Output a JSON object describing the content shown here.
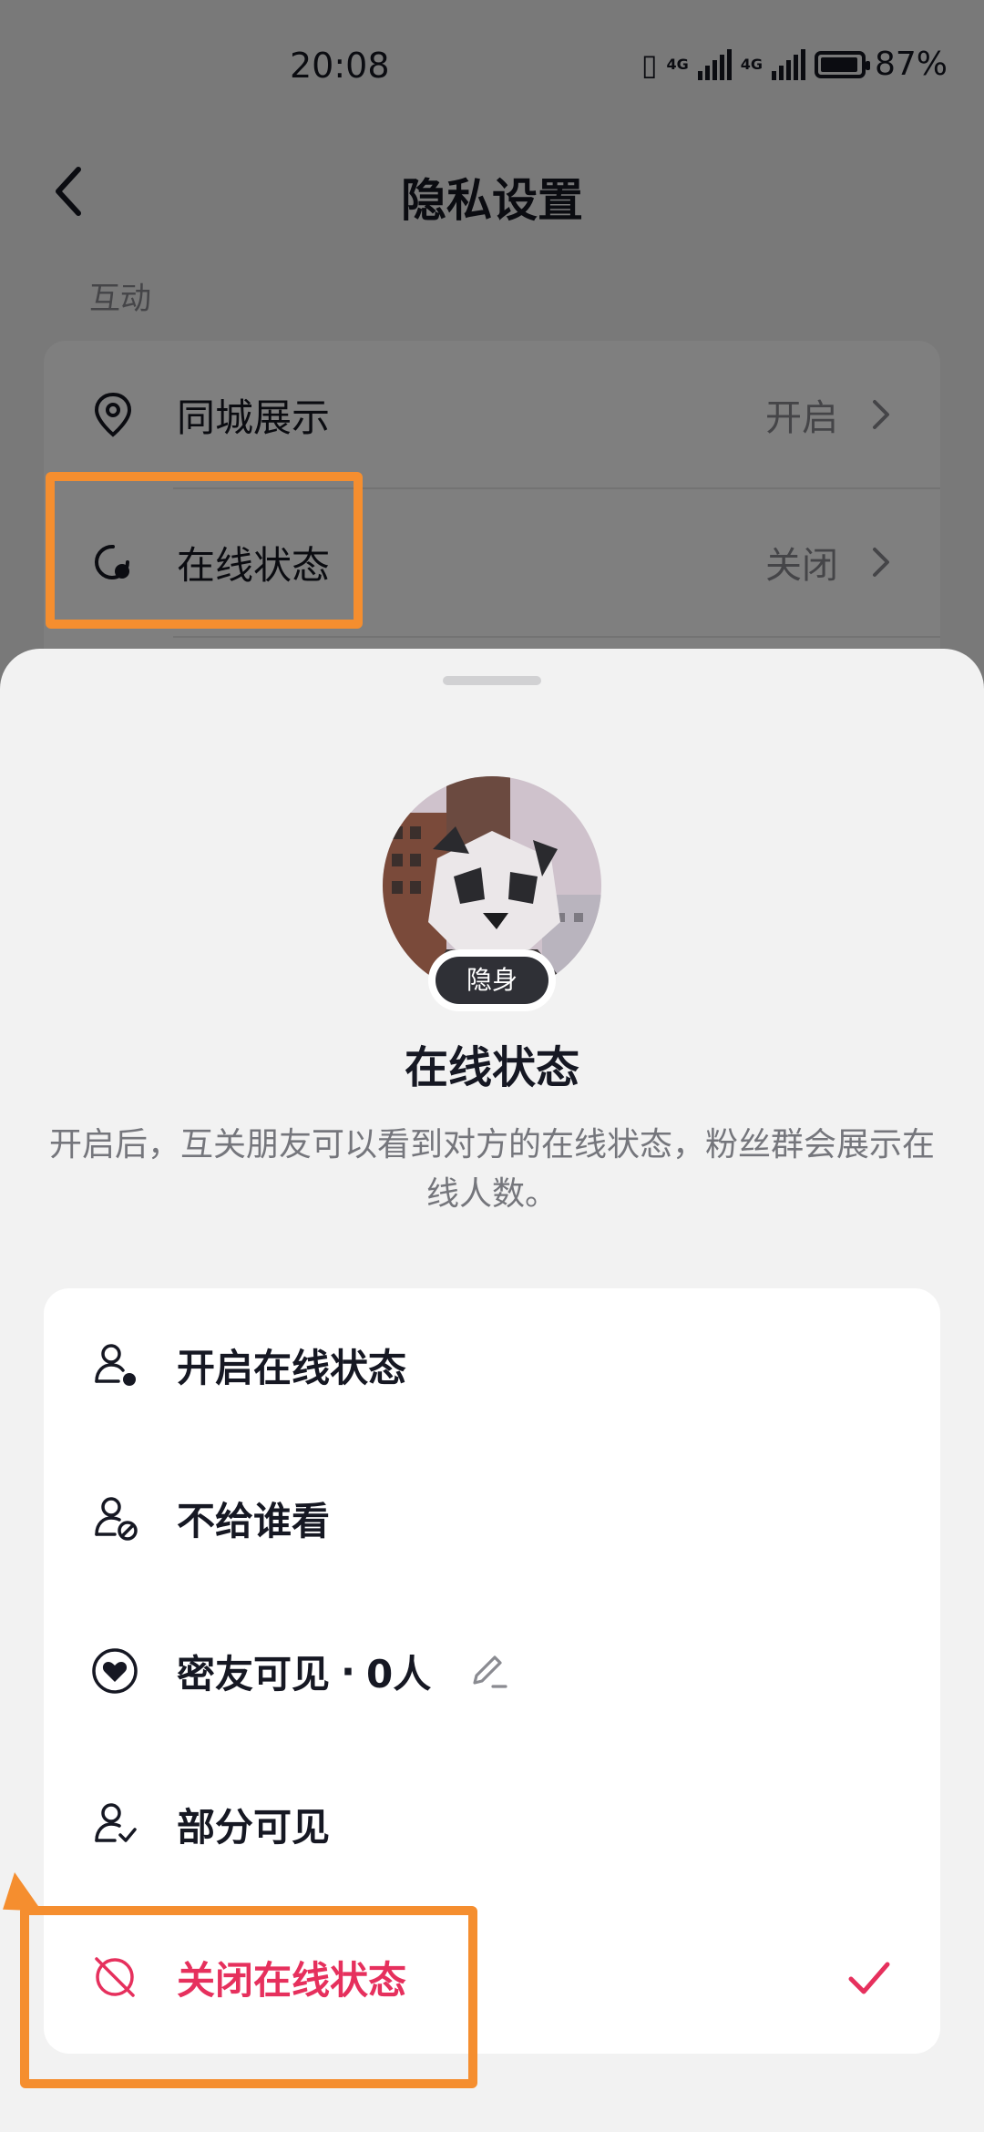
{
  "status_bar": {
    "time": "20:08",
    "net1": "4G",
    "net2": "4G",
    "battery": "87%"
  },
  "header": {
    "title": "隐私设置",
    "back_icon": "chevron-left-icon"
  },
  "section": {
    "label": "互动",
    "rows": [
      {
        "label": "同城展示",
        "value": "开启",
        "icon": "location-pin-icon"
      },
      {
        "label": "在线状态",
        "value": "关闭",
        "icon": "online-status-icon"
      }
    ]
  },
  "sheet": {
    "badge": "隐身",
    "title": "在线状态",
    "description": "开启后，互关朋友可以看到对方的在线状态，粉丝群会展示在线人数。",
    "options": [
      {
        "label": "开启在线状态",
        "icon": "user-online-icon",
        "selected": false
      },
      {
        "label": "不给谁看",
        "icon": "user-block-icon",
        "selected": false
      },
      {
        "label": "密友可见",
        "sep": "·",
        "count": "0人",
        "icon": "heart-circle-icon",
        "selected": false
      },
      {
        "label": "部分可见",
        "icon": "user-check-icon",
        "selected": false
      },
      {
        "label": "关闭在线状态",
        "icon": "offline-icon",
        "selected": true
      }
    ]
  },
  "colors": {
    "accent": "#e6305d",
    "highlight": "#f58e2f",
    "text_primary": "#161823",
    "text_secondary": "#8a8b91"
  }
}
